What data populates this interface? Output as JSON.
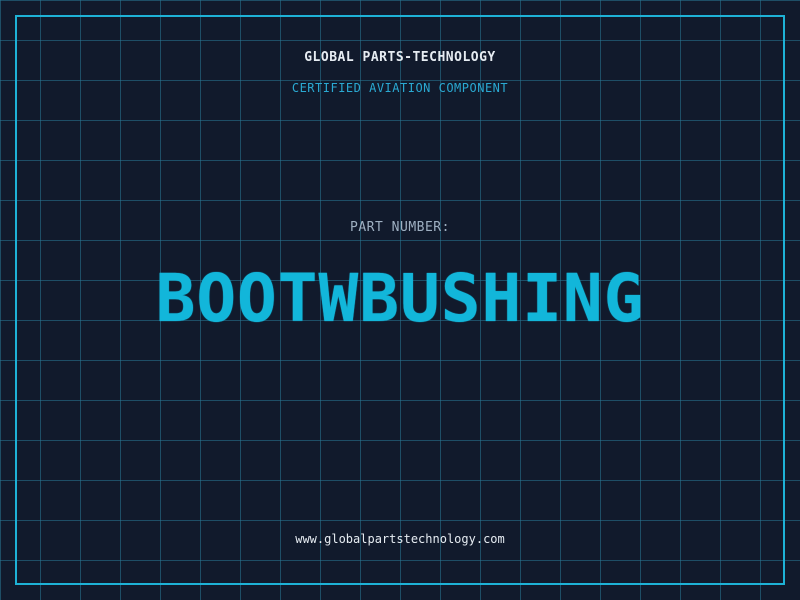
{
  "header": {
    "company": "GLOBAL PARTS-TECHNOLOGY",
    "subtitle": "CERTIFIED AVIATION COMPONENT"
  },
  "part": {
    "label": "PART NUMBER:",
    "number": "BOOTWBUSHING"
  },
  "footer": {
    "url": "www.globalpartstechnology.com"
  },
  "colors": {
    "background": "#111a2c",
    "grid": "#28788c",
    "frame": "#1eb2d6",
    "accent": "#12b6da",
    "text": "#e6ecf2"
  }
}
